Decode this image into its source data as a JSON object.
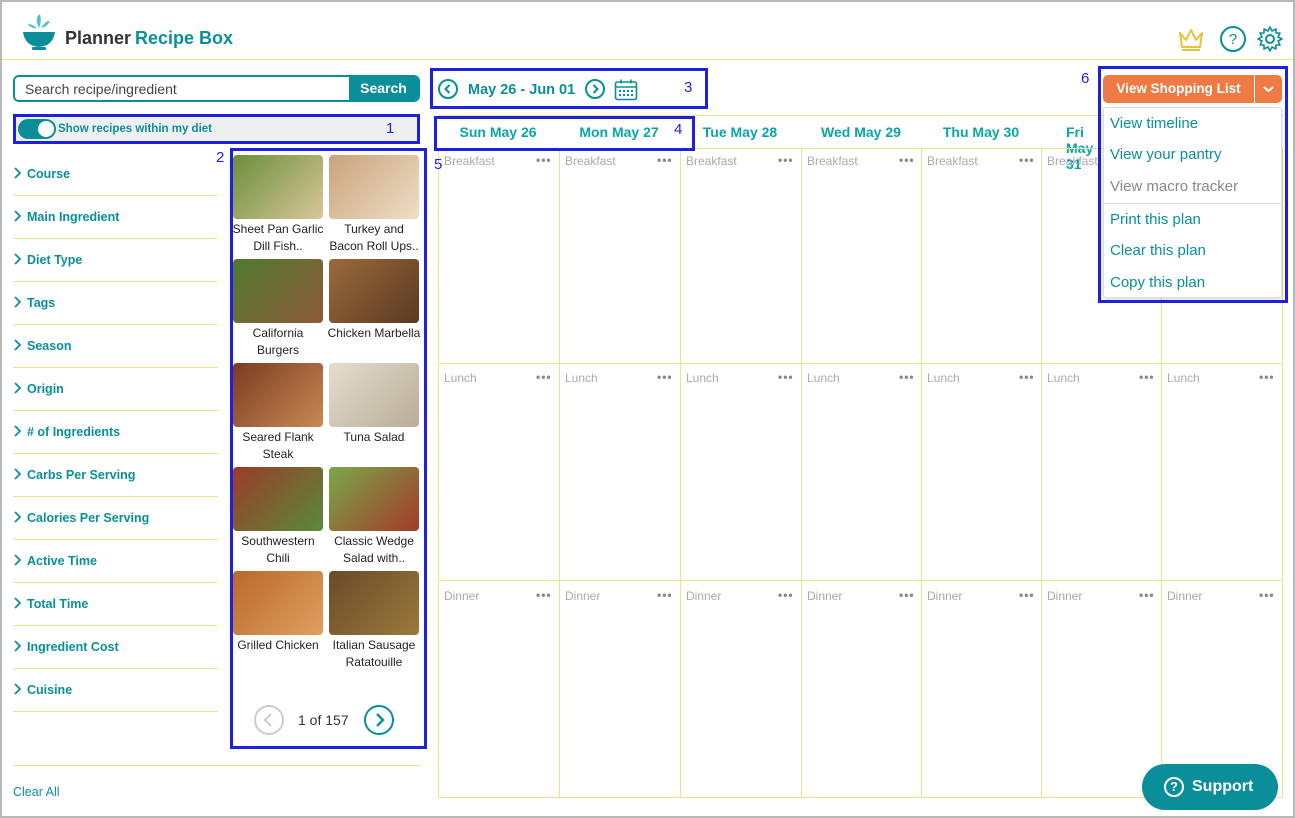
{
  "header": {
    "planner_label": "Planner",
    "recipe_box_label": "Recipe Box",
    "icons": [
      "crown-icon",
      "help-icon",
      "settings-icon"
    ]
  },
  "search": {
    "placeholder": "Search recipe/ingredient",
    "button_label": "Search"
  },
  "diet_toggle": {
    "label": "Show recipes within my diet",
    "on": true
  },
  "filters": [
    "Course",
    "Main Ingredient",
    "Diet Type",
    "Tags",
    "Season",
    "Origin",
    "# of Ingredients",
    "Carbs Per Serving",
    "Calories Per Serving",
    "Active Time",
    "Total Time",
    "Ingredient Cost",
    "Cuisine"
  ],
  "clear_all_label": "Clear All",
  "recipes": [
    {
      "name": "Sheet Pan Garlic Dill Fish.."
    },
    {
      "name": "Turkey and Bacon Roll Ups.."
    },
    {
      "name": "California Burgers"
    },
    {
      "name": "Chicken Marbella"
    },
    {
      "name": "Seared Flank Steak"
    },
    {
      "name": "Tuna Salad"
    },
    {
      "name": "Southwestern Chili"
    },
    {
      "name": "Classic Wedge Salad with.."
    },
    {
      "name": "Grilled Chicken"
    },
    {
      "name": "Italian Sausage Ratatouille"
    }
  ],
  "pager": {
    "text": "1 of 157"
  },
  "planner": {
    "date_range": "May 26 - Jun 01",
    "days": [
      "Sun May 26",
      "Mon May 27",
      "Tue May 28",
      "Wed May 29",
      "Thu May 30",
      "Fri May 31",
      ""
    ],
    "meals": [
      "Breakfast",
      "Lunch",
      "Dinner"
    ],
    "dots": "•••"
  },
  "shopping": {
    "button_label": "View Shopping List",
    "menu": [
      {
        "label": "View timeline",
        "enabled": true
      },
      {
        "label": "View your pantry",
        "enabled": true
      },
      {
        "label": "View macro tracker",
        "enabled": false
      },
      {
        "label": "Print this plan",
        "enabled": true
      },
      {
        "label": "Clear this plan",
        "enabled": true
      },
      {
        "label": "Copy this plan",
        "enabled": true
      }
    ]
  },
  "annotations": [
    "1",
    "2",
    "3",
    "4",
    "5",
    "6"
  ],
  "support_label": "Support",
  "colors": {
    "teal": "#0a8f9a",
    "orange": "#ef7a43",
    "annotation": "#1f1fe0",
    "grid": "#f0e28c"
  }
}
